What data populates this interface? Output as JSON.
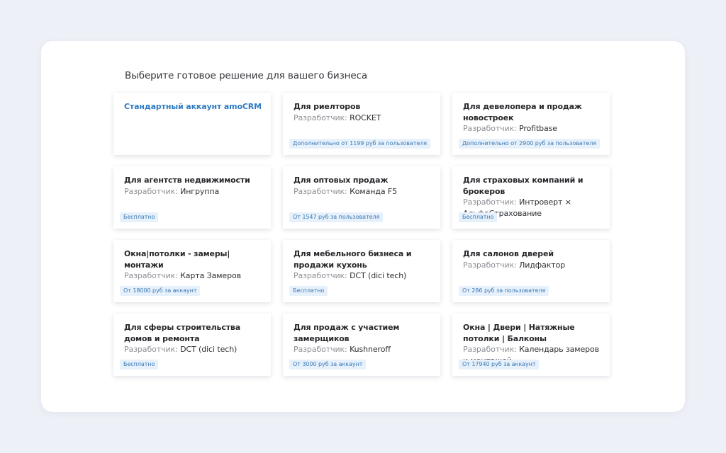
{
  "page": {
    "heading": "Выберите готовое решение для вашего бизнеса"
  },
  "dev_label": "Разработчик: ",
  "colors": {
    "background": "#eef0f7",
    "panel": "#ffffff",
    "accent": "#2f7cc2",
    "badge_bg": "#e7f1fb",
    "badge_text": "#3a78b4"
  },
  "cards": [
    {
      "title": "Стандартный аккаунт amoCRM",
      "developer": "",
      "price": ""
    },
    {
      "title": "Для риелторов",
      "developer": "ROCKET",
      "price": "Дополнительно от 1199 руб за пользователя"
    },
    {
      "title": "Для девелопера и продаж новостроек",
      "developer": "Profitbase",
      "price": "Дополнительно от 2900 руб за пользователя"
    },
    {
      "title": "Для агентств недвижимости",
      "developer": "Ингруппа",
      "price": "Бесплатно"
    },
    {
      "title": "Для оптовых продаж",
      "developer": "Команда F5",
      "price": "От 1547 руб за пользователя"
    },
    {
      "title": "Для страховых компаний и брокеров",
      "developer": "Интроверт × АльфаСтрахование",
      "price": "Бесплатно"
    },
    {
      "title": "Окна|потолки - замеры|монтажи",
      "developer": "Карта Замеров",
      "price": "От 18000 руб за аккаунт"
    },
    {
      "title": "Для мебельного бизнеса и продажи кухонь",
      "developer": "DCT (dici tech)",
      "price": "Бесплатно"
    },
    {
      "title": "Для салонов дверей",
      "developer": "Лидфактор",
      "price": "От 286 руб за пользователя"
    },
    {
      "title": "Для сферы строительства домов и ремонта",
      "developer": "DCT (dici tech)",
      "price": "Бесплатно"
    },
    {
      "title": "Для продаж с участием замерщиков",
      "developer": "Kushneroff",
      "price": "От 3000 руб за аккаунт"
    },
    {
      "title": "Окна | Двери | Натяжные потолки | Балконы",
      "developer": "Календарь замеров и монтажей",
      "price": "От 17940 руб за аккаунт"
    }
  ]
}
